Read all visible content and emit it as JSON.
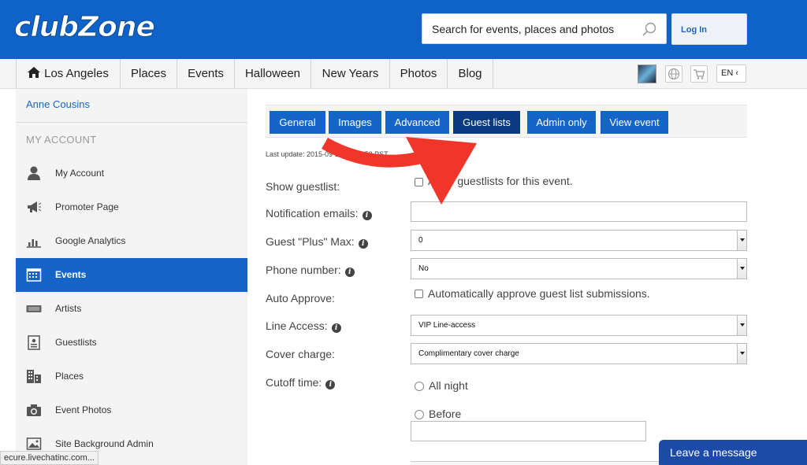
{
  "header": {
    "logo": "clubZone",
    "search_placeholder": "Search for events, places and photos",
    "login_label": "Log In"
  },
  "nav": {
    "items": [
      "Los Angeles",
      "Places",
      "Events",
      "Halloween",
      "New Years",
      "Photos",
      "Blog"
    ],
    "lang": "EN ‹"
  },
  "sidebar": {
    "user": "Anne Cousins",
    "section": "MY ACCOUNT",
    "items": [
      {
        "label": "My Account",
        "icon": "user-icon"
      },
      {
        "label": "Promoter Page",
        "icon": "megaphone-icon"
      },
      {
        "label": "Google Analytics",
        "icon": "bar-chart-icon"
      },
      {
        "label": "Events",
        "icon": "calendar-icon",
        "active": true
      },
      {
        "label": "Artists",
        "icon": "ticket-icon"
      },
      {
        "label": "Guestlists",
        "icon": "clipboard-icon"
      },
      {
        "label": "Places",
        "icon": "building-icon"
      },
      {
        "label": "Event Photos",
        "icon": "camera-icon"
      },
      {
        "label": "Site Background Admin",
        "icon": "image-icon"
      }
    ]
  },
  "tabs": [
    "General",
    "Images",
    "Advanced",
    "Guest lists",
    "Admin only",
    "View event"
  ],
  "active_tab": "Guest lists",
  "last_update": "Last update: 2015-09-20 22:10:58 PST.",
  "form": {
    "show_guestlist_label": "Show guestlist:",
    "show_guestlist_check": "Allow guestlists for this event.",
    "notification_label": "Notification emails:",
    "notification_value": "",
    "plus_max_label": "Guest \"Plus\" Max:",
    "plus_max_value": "0",
    "phone_label": "Phone number:",
    "phone_value": "No",
    "auto_approve_label": "Auto Approve:",
    "auto_approve_check": "Automatically approve guest list submissions.",
    "line_access_label": "Line Access:",
    "line_access_value": "VIP Line-access",
    "cover_label": "Cover charge:",
    "cover_value": "Complimentary cover charge",
    "cutoff_label": "Cutoff time:",
    "cutoff_all_night": "All night",
    "cutoff_before": "Before",
    "cutoff_before_value": ""
  },
  "status_url": "ecure.livechatinc.com...",
  "chat_label": "Leave a message",
  "colors": {
    "brand": "#0f63c8",
    "tab": "#1565c8",
    "tab_active": "#0a3a80",
    "annotation_arrow": "#f0362a"
  }
}
